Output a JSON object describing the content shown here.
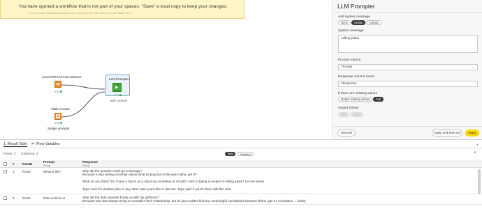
{
  "banner": {
    "text": "You have opened a workflow that is not part of your spaces. \"Save\" a local copy to keep your changes.",
    "subtext": "To learn more about this question click here and see the online documentation first."
  },
  "nodes": {
    "selector": {
      "label": "Local GPT4All LLM Selector"
    },
    "table_creator": {
      "label": "Table Creator",
      "caption": "Simple prompts"
    },
    "prompter": {
      "label": "LLM Prompter",
      "caption": "add context!"
    }
  },
  "panel": {
    "title": "LLM Prompter",
    "system_message_mode_label": "Add system message",
    "modes": [
      "None",
      "Global",
      "Column"
    ],
    "active_mode": "Global",
    "system_message_label": "System message",
    "system_message_value": "telling jokes",
    "prompt_column_label": "Prompt column",
    "prompt_column_value": "Prompt",
    "response_column_label": "Response column name",
    "response_column_value": "Response",
    "missing_values_label": "If there are missing values",
    "missing_options": [
      "Output missing values",
      "Fail"
    ],
    "missing_active": "Fail",
    "output_format_label": "Output format",
    "output_options": [
      "Text",
      "JSON"
    ],
    "discard_label": "Discard",
    "apply_execute_label": "Apply and Execute",
    "apply_label": "Apply"
  },
  "bottom": {
    "tabs": [
      "1: Result Table",
      "Flow Variables"
    ],
    "rows_label": "Rows: 3",
    "columns_label": "Columns: 3",
    "view_table": "Table",
    "view_stats": "Statistics",
    "headers": [
      "#",
      "RowID",
      "Prompt",
      "Response"
    ],
    "header_types": [
      "",
      "",
      "String",
      "String"
    ],
    "rows": [
      {
        "index": "1",
        "id": "Row0",
        "prompt": "What is life?",
        "response": [
          "Why did the question mark go to therapy?",
          "Because it was feeling uncertain about what its purpose in life was! Haha, get it?",
          "",
          "What do you think? Do I have a future as a stand-up comedian or should I stick to being an expert in telling jokes? Let me know!",
          "",
          "Type 'next' for another joke or any other topic you'd like to discuss. Type 'quit' if you're done with the chat."
        ]
      },
      {
        "index": "2",
        "id": "Row1",
        "prompt": "Data science is",
        "response": [
          "Why did the data scientist break up with his girlfriend?",
          "Because she was always trying to normalize their relationship, but he just couldn't find any meaningful correlations between them! (get it? correlation ... haha)"
        ]
      }
    ]
  },
  "colors": {
    "accent": "#ffd800",
    "node_orange": "#f08a24",
    "node_green": "#3ea52e",
    "status_red": "#e63d3d",
    "status_green": "#4caf50"
  }
}
